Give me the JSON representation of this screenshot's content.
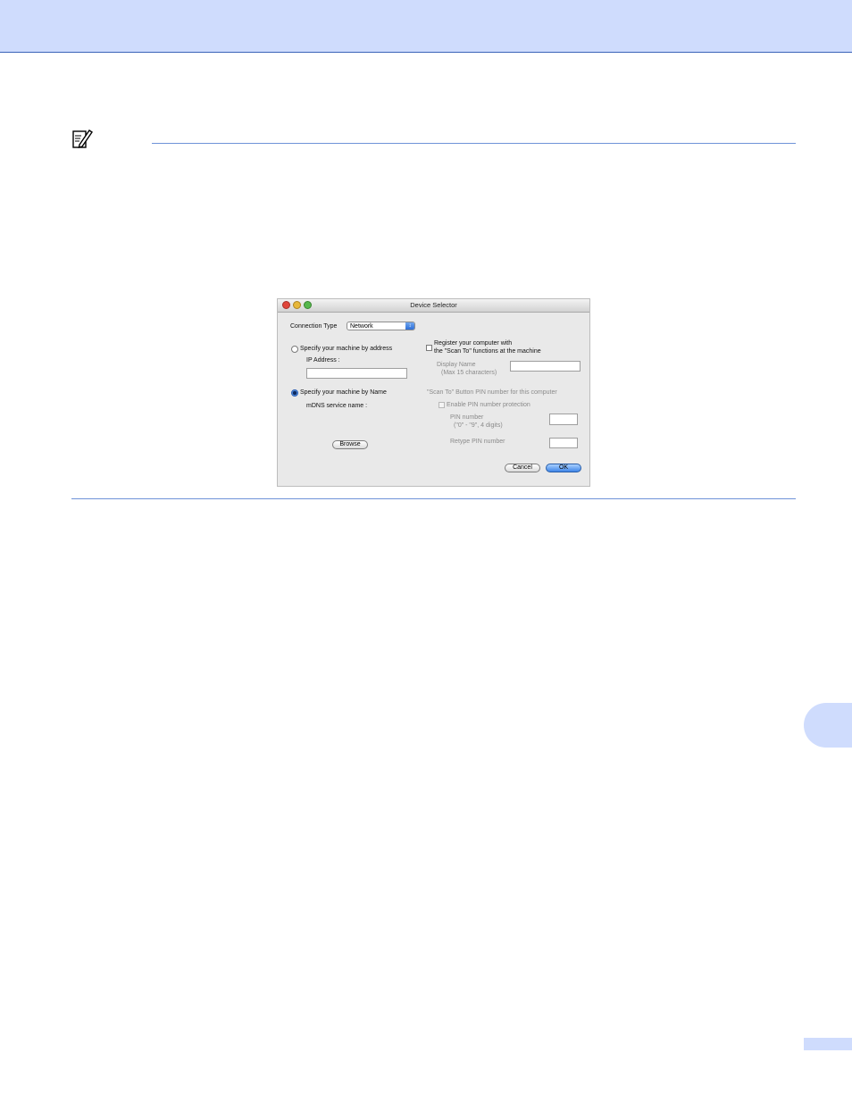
{
  "dialog": {
    "title": "Device Selector",
    "connection_type_label": "Connection Type",
    "connection_type_value": "Network",
    "specify_by_address_label": "Specify your machine by address",
    "ip_address_label": "IP Address :",
    "ip_address_value": "",
    "specify_by_name_label": "Specify your machine by Name",
    "mdns_label": "mDNS service name :",
    "browse_label": "Browse",
    "register_line1": "Register your computer with",
    "register_line2": "the \"Scan To\" functions at the machine",
    "display_name_label": "Display Name",
    "display_name_hint": "(Max 15 characters)",
    "display_name_value": "",
    "pin_section_label": "\"Scan To\" Button PIN number for this computer",
    "enable_pin_label": "Enable PIN number protection",
    "pin_number_label": "PIN number",
    "pin_number_hint": "(\"0\" - \"9\",  4 digits)",
    "pin_number_value": "",
    "retype_pin_label": "Retype PIN number",
    "retype_pin_value": "",
    "cancel_label": "Cancel",
    "ok_label": "OK",
    "selected_option": "Specify your machine by Name",
    "register_checked": false,
    "enable_pin_checked": false
  },
  "colors": {
    "header_band": "#cfdcfd",
    "rule_line": "#6f93d8",
    "dialog_background": "#e9e9e9",
    "ok_button": "#3f86e8"
  },
  "icons": {
    "note": "note-pencil-icon",
    "select_arrows": "up-down-arrows-icon"
  }
}
